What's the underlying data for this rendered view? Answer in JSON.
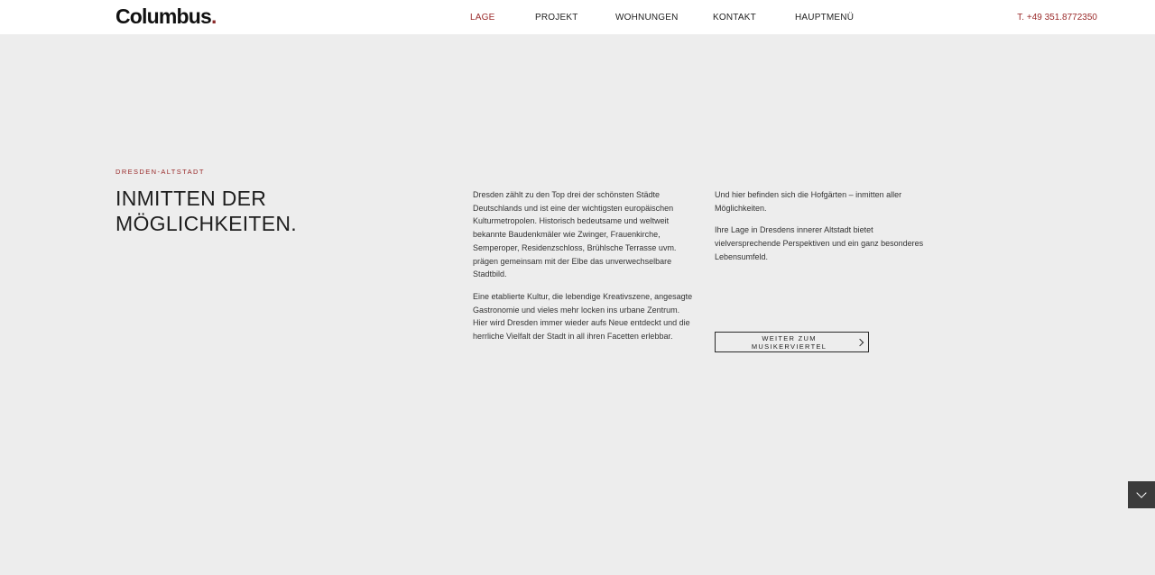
{
  "header": {
    "logo_text": "Columbus",
    "logo_dot": ".",
    "nav": [
      {
        "label": "LAGE",
        "active": true
      },
      {
        "label": "PROJEKT",
        "active": false
      },
      {
        "label": "WOHNUNGEN",
        "active": false
      },
      {
        "label": "KONTAKT",
        "active": false
      },
      {
        "label": "HAUPTMENÜ",
        "active": false
      }
    ],
    "phone": "T. +49 351.8772350"
  },
  "section": {
    "eyebrow": "DRESDEN-ALTSTADT",
    "headline_line1": "INMITTEN DER",
    "headline_line2": "MÖGLICHKEITEN.",
    "col1": [
      "Dresden zählt zu den Top drei der schönsten Städte Deutschlands und ist eine der wichtigsten europäischen Kulturmetropolen. Historisch bedeutsame und weltweit bekannte Baudenkmäler wie Zwinger, Frauenkirche, Semperoper, Residenzschloss, Brühlsche Terrasse uvm. prägen gemeinsam mit der Elbe das unverwechselbare Stadtbild.",
      "Eine etablierte Kultur, die lebendige Kreativszene, angesagte Gastronomie und vieles mehr locken ins urbane Zentrum. Hier wird Dresden immer wieder aufs Neue entdeckt und die herrliche Vielfalt der Stadt in all ihren Facetten erlebbar."
    ],
    "col2": [
      "Und hier befinden sich die Hofgärten – inmitten aller Möglichkeiten.",
      "Ihre Lage in Dresdens innerer Altstadt bietet vielversprechende Perspektiven und ein ganz besonderes Lebensumfeld."
    ],
    "cta_label": "WEITER ZUM MUSIKERVIERTEL"
  },
  "scroll_button": {
    "icon": "chevron-down-icon"
  },
  "colors": {
    "accent": "#9a2b2b",
    "background": "#ededed",
    "header_bg": "#ffffff",
    "scroll_btn_bg": "#3b3b3b"
  }
}
